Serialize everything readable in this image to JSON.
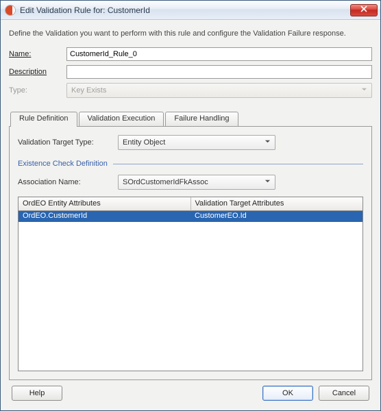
{
  "window": {
    "title": "Edit Validation Rule for: CustomerId"
  },
  "instructions": "Define the Validation you want to perform with this rule and configure the Validation Failure response.",
  "form": {
    "name_label": "Name:",
    "name_value": "CustomerId_Rule_0",
    "description_label": "Description",
    "description_value": "",
    "type_label": "Type:",
    "type_value": "Key Exists"
  },
  "tabs": {
    "definition": "Rule Definition",
    "execution": "Validation Execution",
    "failure": "Failure Handling"
  },
  "panel": {
    "target_type_label": "Validation Target Type:",
    "target_type_value": "Entity Object",
    "section_title": "Existence Check Definition",
    "assoc_label": "Association Name:",
    "assoc_value": "SOrdCustomerIdFkAssoc",
    "columns": {
      "left": "OrdEO Entity Attributes",
      "right": "Validation Target Attributes"
    },
    "rows": [
      {
        "left": "OrdEO.CustomerId",
        "right": "CustomerEO.Id"
      }
    ]
  },
  "buttons": {
    "help": "Help",
    "ok": "OK",
    "cancel": "Cancel"
  }
}
